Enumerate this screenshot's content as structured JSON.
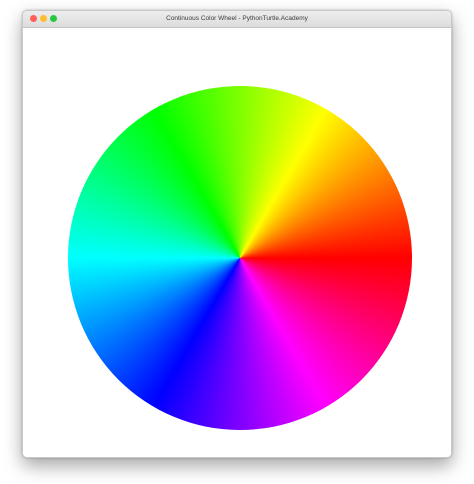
{
  "window": {
    "title": "Continuous Color Wheel - PythonTurtle.Academy",
    "traffic_lights": {
      "close_color": "#ff5f57",
      "minimize_color": "#febc2e",
      "zoom_color": "#28c840"
    }
  },
  "canvas": {
    "background": "#ffffff",
    "wheel": {
      "type": "continuous-hue-wheel",
      "hue_start_color": "#ff0000",
      "hue_direction": "counterclockwise"
    }
  }
}
